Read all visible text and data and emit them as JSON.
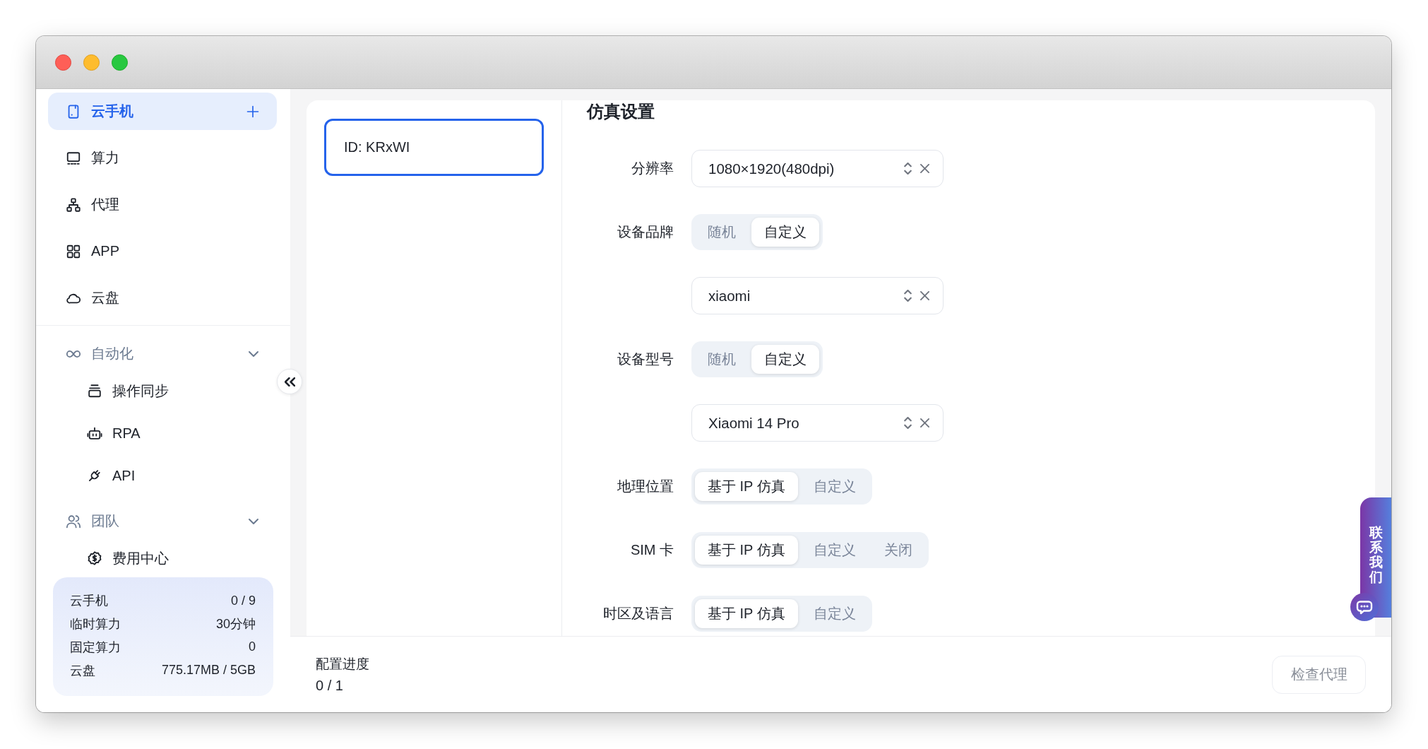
{
  "sidebar": {
    "nav": [
      {
        "label": "云手机",
        "selected": true,
        "add_button": true
      },
      {
        "label": "算力",
        "selected": false
      },
      {
        "label": "代理",
        "selected": false
      },
      {
        "label": "APP",
        "selected": false
      },
      {
        "label": "云盘",
        "selected": false
      }
    ],
    "groups": [
      {
        "label": "自动化",
        "expanded": true,
        "children": [
          {
            "label": "操作同步",
            "selected": false
          },
          {
            "label": "RPA",
            "selected": false
          },
          {
            "label": "API",
            "selected": false
          }
        ]
      },
      {
        "label": "团队",
        "expanded": true,
        "children": [
          {
            "label": "费用中心",
            "selected": false
          }
        ]
      }
    ],
    "usage": [
      {
        "label": "云手机",
        "value": "0 / 9"
      },
      {
        "label": "临时算力",
        "value": "30分钟"
      },
      {
        "label": "固定算力",
        "value": "0"
      },
      {
        "label": "云盘",
        "value": "775.17MB / 5GB"
      }
    ]
  },
  "devices": [
    {
      "label": "ID: KRxWI",
      "selected": true
    }
  ],
  "settings": {
    "title": "仿真设置",
    "rows": [
      {
        "kind": "select",
        "label": "分辨率",
        "value": "1080×1920(480dpi)"
      },
      {
        "kind": "segmented",
        "label": "设备品牌",
        "options": [
          {
            "label": "随机",
            "selected": false
          },
          {
            "label": "自定义",
            "selected": true
          }
        ]
      },
      {
        "kind": "select",
        "value": "xiaomi"
      },
      {
        "kind": "segmented",
        "label": "设备型号",
        "options": [
          {
            "label": "随机",
            "selected": false
          },
          {
            "label": "自定义",
            "selected": true
          }
        ]
      },
      {
        "kind": "select",
        "value": "Xiaomi 14 Pro"
      },
      {
        "kind": "segmented",
        "label": "地理位置",
        "options": [
          {
            "label": "基于 IP 仿真",
            "selected": true
          },
          {
            "label": "自定义",
            "selected": false
          }
        ]
      },
      {
        "kind": "segmented",
        "label": "SIM 卡",
        "options": [
          {
            "label": "基于 IP 仿真",
            "selected": true
          },
          {
            "label": "自定义",
            "selected": false
          },
          {
            "label": "关闭",
            "selected": false
          }
        ]
      },
      {
        "kind": "segmented",
        "label": "时区及语言",
        "options": [
          {
            "label": "基于 IP 仿真",
            "selected": true
          },
          {
            "label": "自定义",
            "selected": false
          }
        ]
      }
    ]
  },
  "footer": {
    "progress_label": "配置进度",
    "progress_value": "0 / 1",
    "check_button": {
      "label": "检查代理",
      "disabled": true
    }
  },
  "contact_tab": {
    "label": "联系我们"
  }
}
